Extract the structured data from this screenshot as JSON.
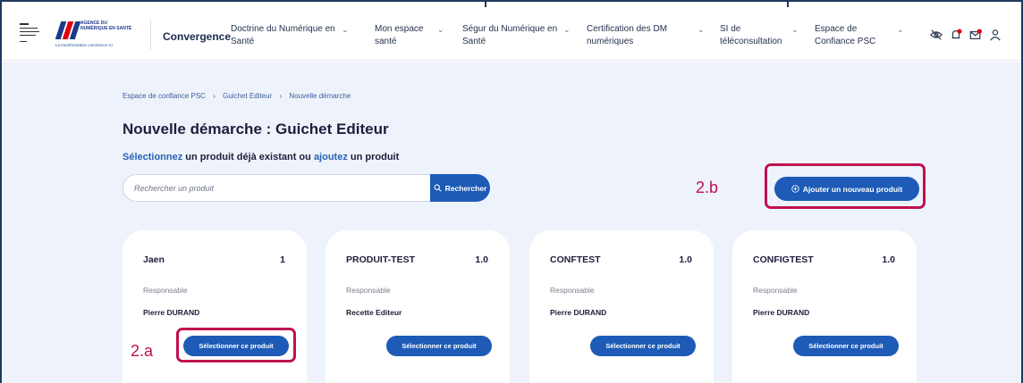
{
  "header": {
    "brand": "Convergence",
    "ans_logo_tag": "AGENCE DU NUMÉRIQUE EN SANTÉ",
    "ans_logo_sub": "La transformation commence ici",
    "nav": [
      {
        "label": "Doctrine du Numérique en Santé"
      },
      {
        "label": "Mon espace santé"
      },
      {
        "label": "Ségur du Numérique en Santé"
      },
      {
        "label": "Certification des DM numériques"
      },
      {
        "label": "SI de téléconsultation"
      },
      {
        "label": "Espace de Confiance PSC"
      }
    ],
    "icons": [
      "eye-slash-icon",
      "bell-icon",
      "mail-icon",
      "user-icon"
    ],
    "notification_color": "#e1000f"
  },
  "breadcrumb": {
    "items": [
      "Espace de confiance PSC",
      "Guichet Editeur",
      "Nouvelle démarche"
    ]
  },
  "page": {
    "title": "Nouvelle démarche : Guichet Editeur",
    "subtitle": {
      "link1": "Sélectionnez",
      "text1": " un produit déjà existant ou ",
      "link2": "ajoutez",
      "text2": " un produit"
    }
  },
  "search": {
    "placeholder": "Rechercher un produit",
    "button_label": "Rechercher"
  },
  "add_button_label": "Ajouter un nouveau produit",
  "annotations": {
    "a": "2.a",
    "b": "2.b",
    "color": "#c0114f"
  },
  "products": [
    {
      "name": "Jaen",
      "version": "1",
      "role_label": "Responsable",
      "person": "Pierre DURAND",
      "button": "Sélectionner ce produit"
    },
    {
      "name": "PRODUIT-TEST",
      "version": "1.0",
      "role_label": "Responsable",
      "person": "Recette Editeur",
      "button": "Sélectionner ce produit"
    },
    {
      "name": "CONFTEST",
      "version": "1.0",
      "role_label": "Responsable",
      "person": "Pierre DURAND",
      "button": "Sélectionner ce produit"
    },
    {
      "name": "CONFIGTEST",
      "version": "1.0",
      "role_label": "Responsable",
      "person": "Pierre DURAND",
      "button": "Sélectionner ce produit"
    }
  ],
  "colors": {
    "accent": "#1d5bb6",
    "background": "#eef3fb",
    "link": "#2a63b8"
  }
}
